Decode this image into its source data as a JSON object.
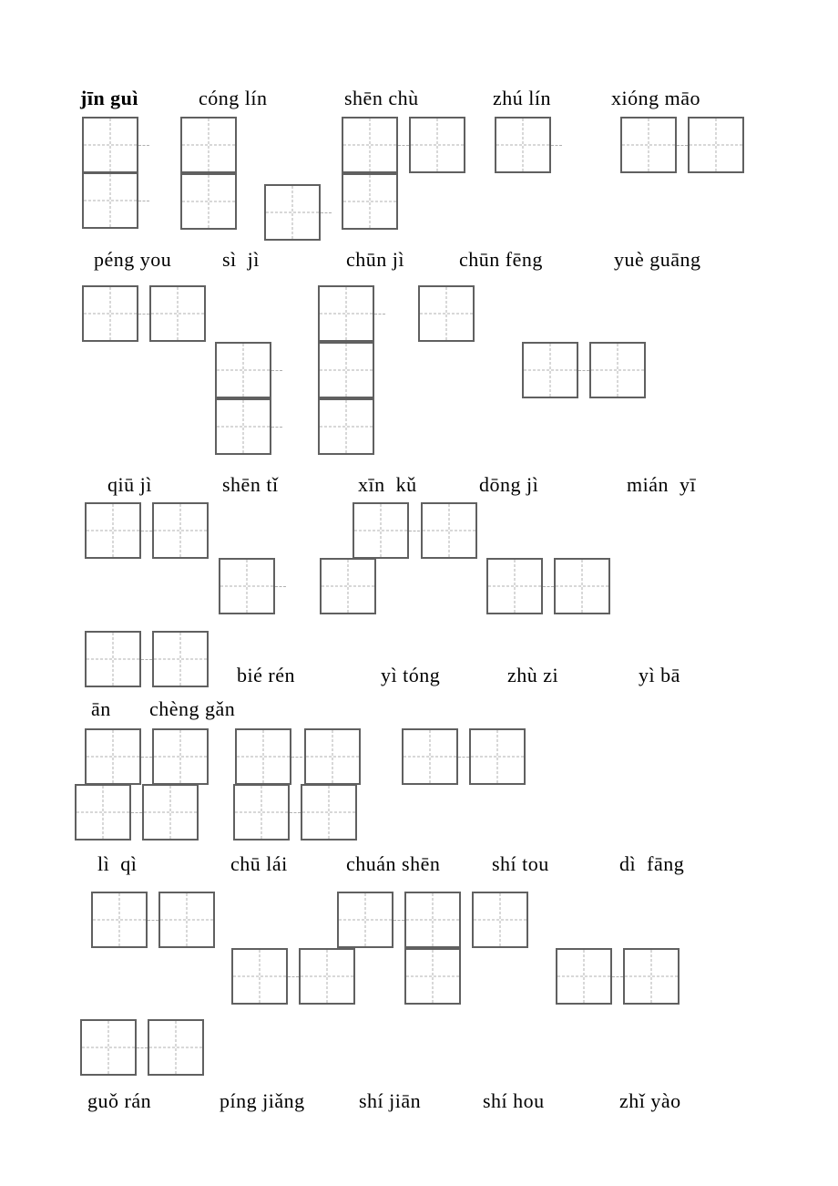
{
  "line1": {
    "a": "jīn guì",
    "b": "cóng lín",
    "c": "shēn chù",
    "d": "zhú lín",
    "e": "xióng māo"
  },
  "line2": {
    "a": "péng you",
    "b": "sì  jì",
    "c": "chūn jì",
    "d": "chūn fēng",
    "e": "yuè guāng"
  },
  "line3": {
    "a": "qiū jì",
    "b": "shēn tǐ",
    "c": "xīn  kǔ",
    "d": "dōng jì",
    "e": "mián  yī"
  },
  "line4": {
    "a": "bié rén",
    "b": "yì tóng",
    "c": "zhù zi",
    "d": "yì bā"
  },
  "line5": {
    "a": "ān",
    "b": "chèng gǎn"
  },
  "line6": {
    "a": "lì  qì",
    "b": "chū lái",
    "c": "chuán shēn",
    "d": "shí tou",
    "e": "dì  fāng"
  },
  "line7": {
    "a": "guǒ rán",
    "b": "píng jiǎng",
    "c": "shí jiān",
    "d": "shí hou",
    "e": "zhǐ yào"
  }
}
